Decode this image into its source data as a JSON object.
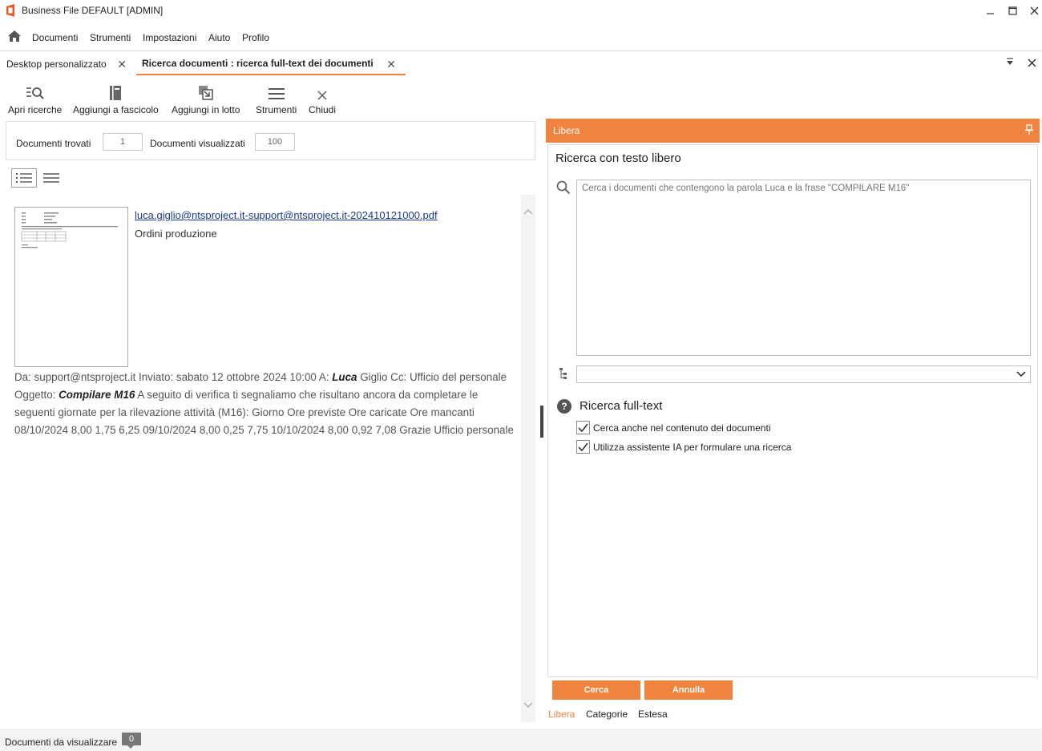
{
  "window": {
    "title": "Business File DEFAULT [ADMIN]"
  },
  "menu": {
    "items": [
      "Documenti",
      "Strumenti",
      "Impostazioni",
      "Aiuto",
      "Profilo"
    ]
  },
  "tabs": [
    {
      "label": "Desktop personalizzato",
      "active": false
    },
    {
      "label": "Ricerca documenti : ricerca full-text dei documenti",
      "active": true
    }
  ],
  "toolbar": {
    "open_searches": "Apri ricerche",
    "add_to_folder": "Aggiungi a fascicolo",
    "add_to_batch": "Aggiungi in lotto",
    "tools": "Strumenti",
    "close": "Chiudi"
  },
  "results": {
    "found_label": "Documenti trovati",
    "found_value": "1",
    "shown_label": "Documenti visualizzati",
    "shown_value": "100",
    "document": {
      "filename": "luca.giglio@ntsproject.it-support@ntsproject.it-202410121000.pdf",
      "category": "Ordini produzione",
      "snippet_1": "Da: support@ntsproject.it Inviato: sabato 12 ottobre 2024 10:00 A: ",
      "snippet_bold_1": "Luca",
      "snippet_2": " Giglio Cc: Ufficio del personale Oggetto: ",
      "snippet_bold_2": "Compilare M16",
      "snippet_3": " A seguito di verifica ti segnaliamo che risultano ancora da completare le seguenti giornate per la rilevazione attività (M16): Giorno Ore previste Ore caricate Ore mancanti 08/10/2024 8,00 1,75 6,25 09/10/2024 8,00 0,25 7,75 10/10/2024 8,00 0,92 7,08 Grazie Ufficio personale"
    }
  },
  "search_panel": {
    "header": "Libera",
    "title": "Ricerca con testo libero",
    "placeholder": "Cerca i documenti che contengono la parola Luca e la frase \"COMPILARE M16\"",
    "fulltext_title": "Ricerca full-text",
    "help_glyph": "?",
    "options": [
      {
        "label": "Cerca anche nel contenuto dei documenti",
        "checked": true
      },
      {
        "label": "Utilizza assistente IA per formulare una ricerca",
        "checked": true
      }
    ],
    "search_button": "Cerca",
    "cancel_button": "Annulla",
    "bottom_tabs": [
      "Libera",
      "Categorie",
      "Estesa"
    ]
  },
  "status": {
    "label": "Documenti da visualizzare",
    "count": "0"
  },
  "colors": {
    "accent": "#f0833e",
    "link": "#1a3a8f"
  }
}
